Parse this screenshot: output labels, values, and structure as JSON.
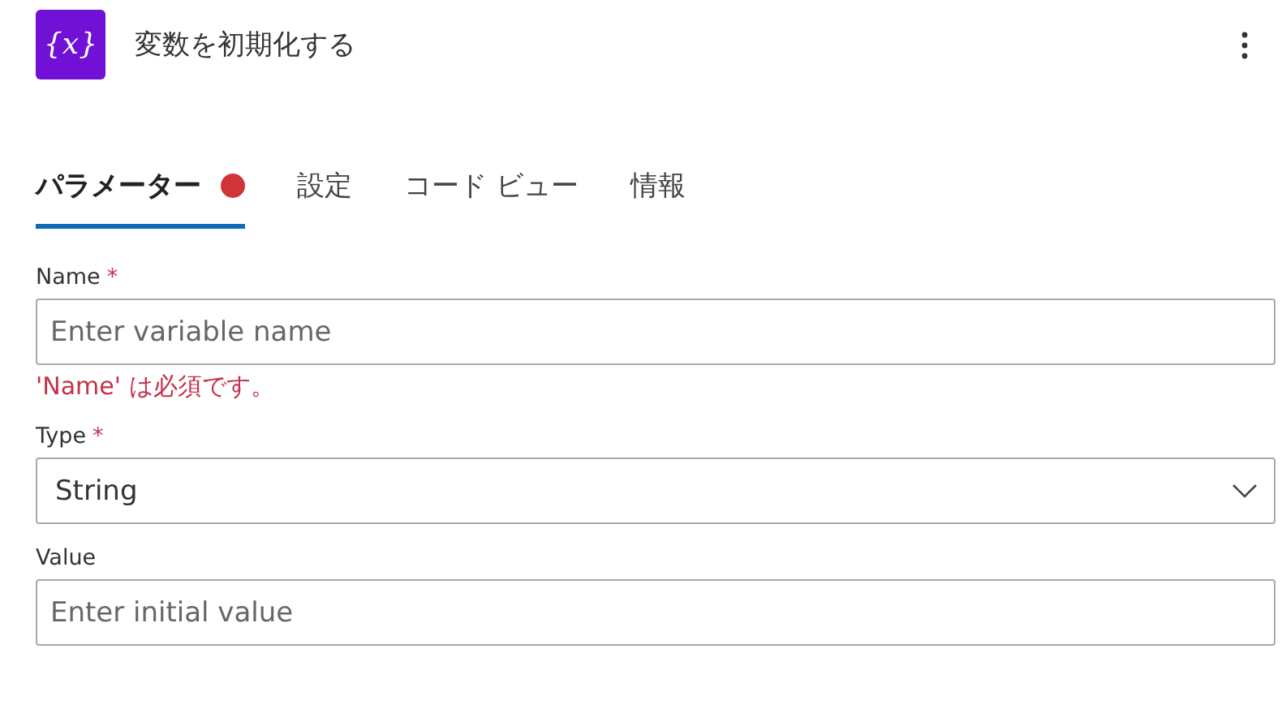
{
  "header": {
    "icon_text": "{x}",
    "title": "変数を初期化する"
  },
  "tabs": [
    {
      "label": "パラメーター",
      "selected": true,
      "error": true
    },
    {
      "label": "設定",
      "selected": false,
      "error": false
    },
    {
      "label": "コード ビュー",
      "selected": false,
      "error": false
    },
    {
      "label": "情報",
      "selected": false,
      "error": false
    }
  ],
  "fields": [
    {
      "kind": "input",
      "label": "Name",
      "required_mark": "*",
      "placeholder": "Enter variable name",
      "error": "'Name' は必須です。"
    },
    {
      "kind": "select",
      "label": "Type",
      "required_mark": "*",
      "value": "String"
    },
    {
      "kind": "input",
      "label": "Value",
      "placeholder": "Enter initial value"
    }
  ]
}
